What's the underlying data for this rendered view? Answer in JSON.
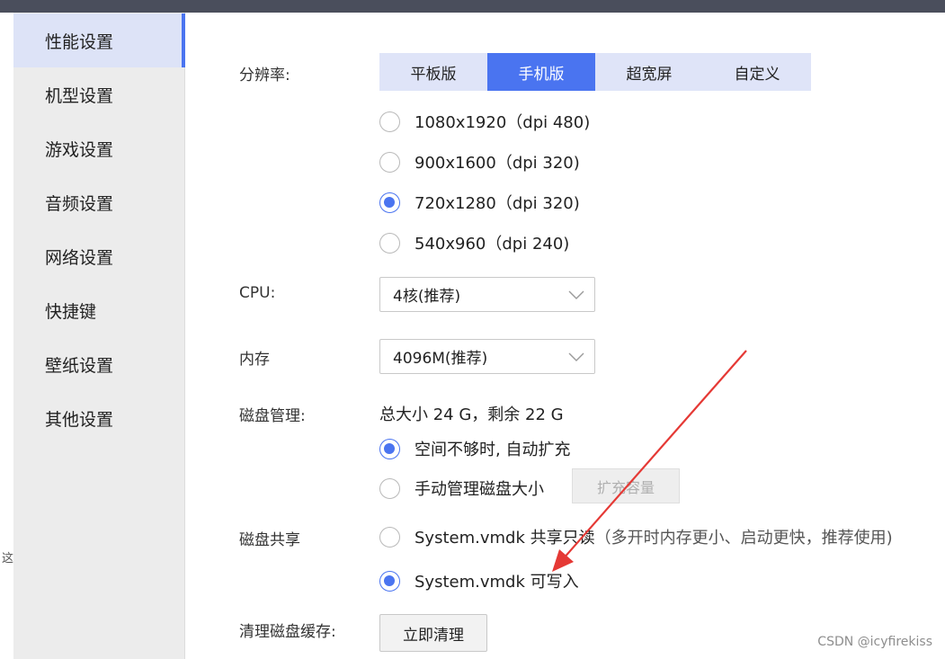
{
  "left_clip_text": "这",
  "sidebar": {
    "items": [
      {
        "label": "性能设置",
        "active": true
      },
      {
        "label": "机型设置",
        "active": false
      },
      {
        "label": "游戏设置",
        "active": false
      },
      {
        "label": "音频设置",
        "active": false
      },
      {
        "label": "网络设置",
        "active": false
      },
      {
        "label": "快捷键",
        "active": false
      },
      {
        "label": "壁纸设置",
        "active": false
      },
      {
        "label": "其他设置",
        "active": false
      }
    ]
  },
  "resolution": {
    "label": "分辨率:",
    "tabs": [
      {
        "label": "平板版",
        "active": false
      },
      {
        "label": "手机版",
        "active": true
      },
      {
        "label": "超宽屏",
        "active": false
      },
      {
        "label": "自定义",
        "active": false
      }
    ],
    "options": [
      {
        "label": "1080x1920（dpi 480)",
        "selected": false
      },
      {
        "label": "900x1600（dpi 320)",
        "selected": false
      },
      {
        "label": "720x1280（dpi 320)",
        "selected": true
      },
      {
        "label": "540x960（dpi 240)",
        "selected": false
      }
    ]
  },
  "cpu": {
    "label": "CPU:",
    "value": "4核(推荐)"
  },
  "memory": {
    "label": "内存",
    "value": "4096M(推荐)"
  },
  "disk": {
    "label": "磁盘管理:",
    "summary": "总大小 24 G，剩余 22 G",
    "options": [
      {
        "label": "空间不够时, 自动扩充",
        "selected": true
      },
      {
        "label": "手动管理磁盘大小",
        "selected": false
      }
    ],
    "expand_button": "扩充容量"
  },
  "disk_share": {
    "label": "磁盘共享",
    "options": [
      {
        "label": "System.vmdk 共享只读",
        "note": "（多开时内存更小、启动更快，推荐使用)",
        "selected": false
      },
      {
        "label": "System.vmdk 可写入",
        "note": "",
        "selected": true
      }
    ]
  },
  "cache": {
    "label": "清理磁盘缓存:",
    "button": "立即清理"
  },
  "watermark": "CSDN @icyfirekiss",
  "colors": {
    "accent": "#4a74f0",
    "tab_bg": "#dfe4f8",
    "arrow": "#e53935",
    "sidebar_bg": "#ececec"
  }
}
